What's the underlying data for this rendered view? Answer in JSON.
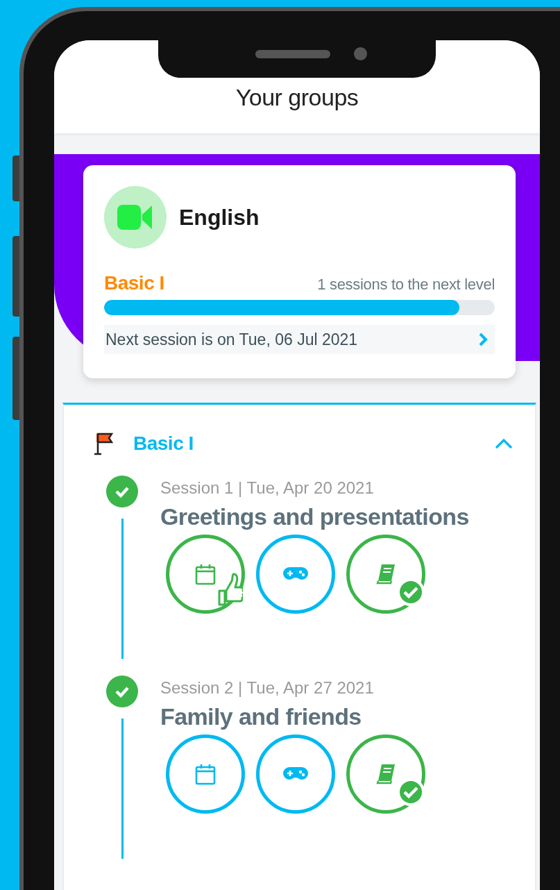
{
  "screen": {
    "title": "Your groups"
  },
  "group": {
    "name": "English",
    "level_name": "Basic I",
    "sessions_to_next": "1 sessions to the next level",
    "progress": {
      "level": 0.91
    },
    "next_session": "Next session is on Tue, 06 Jul 2021"
  },
  "level_section": {
    "title": "Basic I",
    "expanded": true,
    "sessions": [
      {
        "completed": true,
        "meta": "Session 1 | Tue, Apr 20 2021",
        "title": "Greetings and presentations",
        "activities": [
          {
            "kind": "calendar",
            "completed": true,
            "liked": true,
            "checked": false
          },
          {
            "kind": "game",
            "completed": false,
            "liked": false,
            "checked": false
          },
          {
            "kind": "book",
            "completed": true,
            "liked": false,
            "checked": true
          }
        ]
      },
      {
        "completed": true,
        "meta": "Session 2 | Tue, Apr 27 2021",
        "title": "Family and friends",
        "activities": [
          {
            "kind": "calendar",
            "completed": false,
            "liked": false,
            "checked": false
          },
          {
            "kind": "game",
            "completed": false,
            "liked": false,
            "checked": false
          },
          {
            "kind": "book",
            "completed": true,
            "liked": false,
            "checked": true
          }
        ]
      }
    ]
  }
}
